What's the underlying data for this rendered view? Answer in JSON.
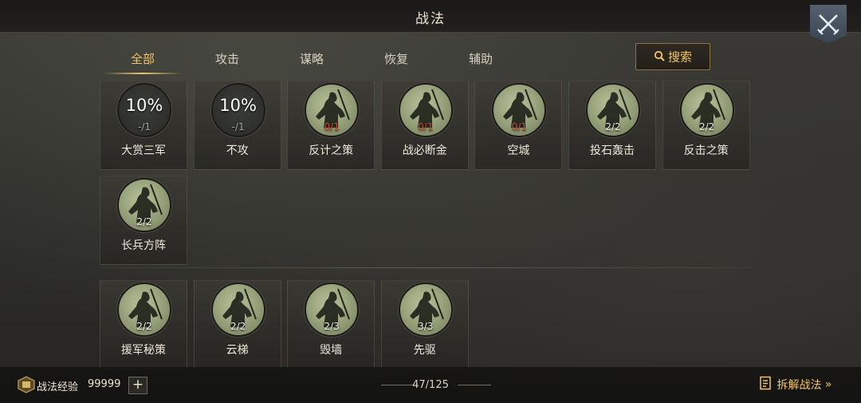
{
  "header": {
    "title": "战法",
    "close_icon": "crossed-swords-icon"
  },
  "tabs": [
    {
      "label": "全部",
      "active": true
    },
    {
      "label": "攻击",
      "active": false
    },
    {
      "label": "谋略",
      "active": false
    },
    {
      "label": "恢复",
      "active": false
    },
    {
      "label": "辅助",
      "active": false
    }
  ],
  "search": {
    "label": "搜索",
    "icon": "search-icon"
  },
  "section1": [
    {
      "name": "大赏三军",
      "percent": "10%",
      "count": "-/1",
      "count_color": "gray"
    },
    {
      "name": "不攻",
      "percent": "10%",
      "count": "-/1",
      "count_color": "gray"
    },
    {
      "name": "反计之策",
      "count": "0/1",
      "count_color": "red"
    },
    {
      "name": "战必断金",
      "count": "0/1",
      "count_color": "red"
    },
    {
      "name": "空城",
      "count": "0/1",
      "count_color": "red"
    },
    {
      "name": "投石轰击",
      "count": "2/2",
      "count_color": "white"
    },
    {
      "name": "反击之策",
      "count": "2/2",
      "count_color": "white"
    },
    {
      "name": "长兵方阵",
      "count": "2/2",
      "count_color": "white"
    }
  ],
  "section2": [
    {
      "name": "援军秘策",
      "count": "2/2",
      "count_color": "white"
    },
    {
      "name": "云梯",
      "count": "2/2",
      "count_color": "white"
    },
    {
      "name": "毁墙",
      "count": "2/3",
      "count_color": "white"
    },
    {
      "name": "先驱",
      "count": "3/3",
      "count_color": "white"
    }
  ],
  "footer": {
    "exp_label": "战法经验",
    "exp_value": "99999",
    "plus_label": "+",
    "page_count": "47/125",
    "disassemble_label": "拆解战法",
    "disassemble_arrow": "»"
  },
  "colors": {
    "accent": "#f1c46b",
    "red_count": "#d24a3a"
  }
}
